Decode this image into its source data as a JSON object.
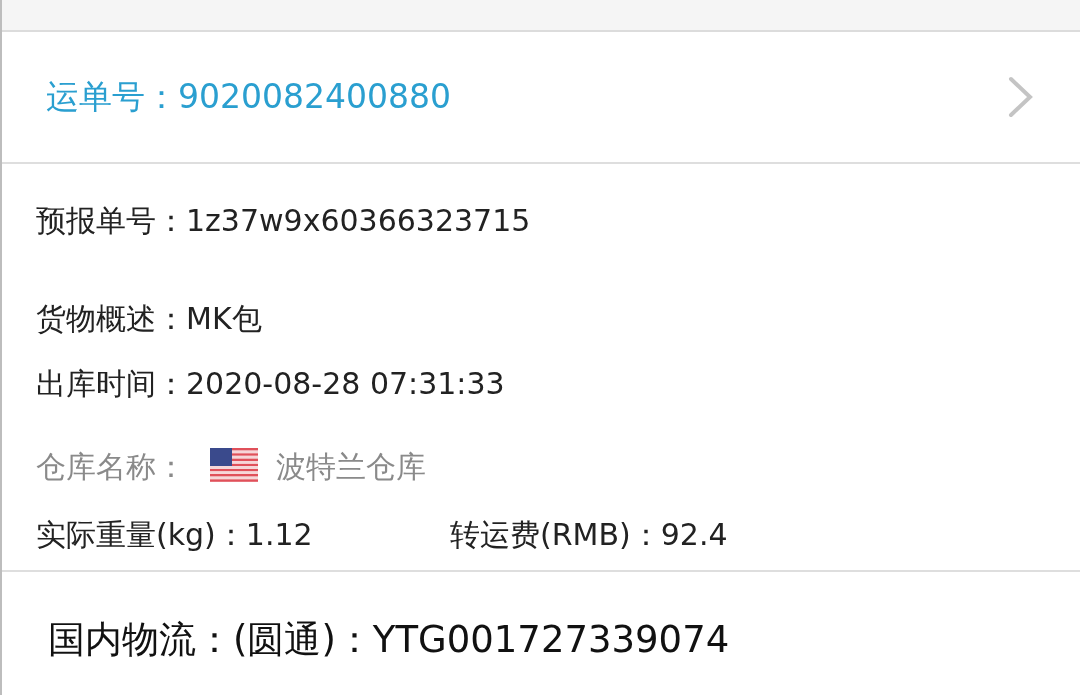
{
  "waybill": {
    "text": "运单号：9020082400880"
  },
  "details": [
    {
      "kind": "text",
      "text": "预报单号：1z37w9x60366323715"
    },
    {
      "kind": "text",
      "text": "货物概述：MK包"
    },
    {
      "kind": "text",
      "text": "出库时间：2020-08-28 07:31:33"
    },
    {
      "kind": "warehouse",
      "label": "仓库名称：",
      "value": "波特兰仓库"
    },
    {
      "kind": "pair",
      "items": [
        "实际重量(kg)：1.12",
        "转运费(RMB)：92.4"
      ]
    }
  ],
  "domestic": {
    "text": "国内物流：(圆通)：YTG001727339074"
  }
}
